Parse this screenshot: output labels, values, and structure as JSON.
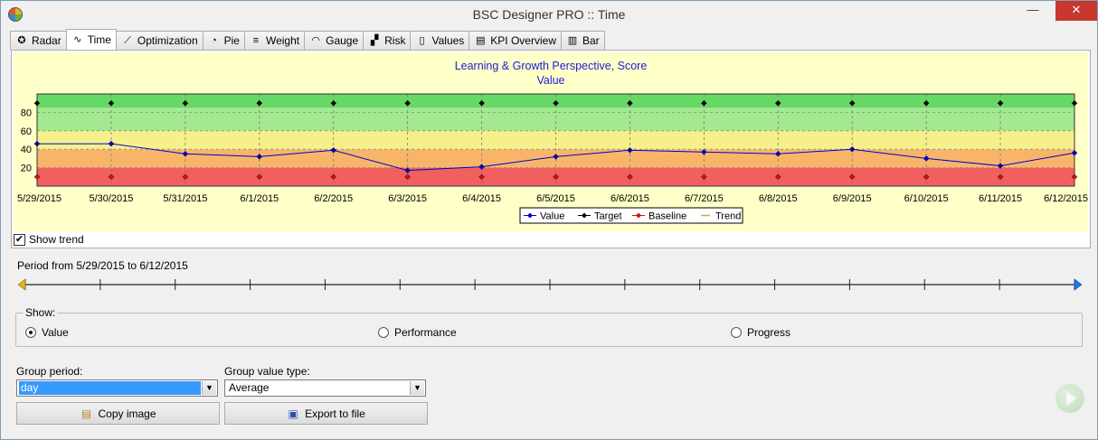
{
  "window": {
    "title": "BSC Designer PRO :: Time",
    "minimize": "—",
    "maximize": "□",
    "close": "✕"
  },
  "tabs": [
    {
      "label": "Radar",
      "icon": "radar-icon",
      "glyph": "✪"
    },
    {
      "label": "Time",
      "icon": "time-chart-icon",
      "glyph": "∿",
      "active": true
    },
    {
      "label": "Optimization",
      "icon": "optimization-icon",
      "glyph": "⟋"
    },
    {
      "label": "Pie",
      "icon": "pie-icon",
      "glyph": "◔"
    },
    {
      "label": "Weight",
      "icon": "weight-icon",
      "glyph": "≡"
    },
    {
      "label": "Gauge",
      "icon": "gauge-icon",
      "glyph": "◠"
    },
    {
      "label": "Risk",
      "icon": "risk-icon",
      "glyph": "▞"
    },
    {
      "label": "Values",
      "icon": "values-icon",
      "glyph": "▯"
    },
    {
      "label": "KPI Overview",
      "icon": "kpi-overview-icon",
      "glyph": "▤"
    },
    {
      "label": "Bar",
      "icon": "bar-icon",
      "glyph": "▥"
    }
  ],
  "chart_data": {
    "type": "line",
    "title": "Learning & Growth Perspective, Score",
    "subtitle": "Value",
    "categories": [
      "5/29/2015",
      "5/30/2015",
      "5/31/2015",
      "6/1/2015",
      "6/2/2015",
      "6/3/2015",
      "6/4/2015",
      "6/5/2015",
      "6/6/2015",
      "6/7/2015",
      "6/8/2015",
      "6/9/2015",
      "6/10/2015",
      "6/11/2015",
      "6/12/2015"
    ],
    "y_ticks": [
      20,
      40,
      60,
      80
    ],
    "ylim": [
      0,
      100
    ],
    "series": [
      {
        "name": "Value",
        "color": "#0000c8",
        "values": [
          46,
          46,
          35,
          32,
          39,
          17,
          21,
          32,
          39,
          37,
          35,
          40,
          30,
          22,
          36
        ]
      },
      {
        "name": "Target",
        "color": "#000000",
        "values": [
          90,
          90,
          90,
          90,
          90,
          90,
          90,
          90,
          90,
          90,
          90,
          90,
          90,
          90,
          90
        ]
      },
      {
        "name": "Baseline",
        "color": "#d01010",
        "values": [
          10,
          10,
          10,
          10,
          10,
          10,
          10,
          10,
          10,
          10,
          10,
          10,
          10,
          10,
          10
        ]
      },
      {
        "name": "Trend",
        "color": "#d9a441",
        "values": []
      }
    ],
    "bands": [
      {
        "from": 0,
        "to": 20,
        "color": "#f25f5f"
      },
      {
        "from": 20,
        "to": 40,
        "color": "#f8b56a"
      },
      {
        "from": 40,
        "to": 60,
        "color": "#f6f08a"
      },
      {
        "from": 60,
        "to": 85,
        "color": "#a3e98f"
      },
      {
        "from": 85,
        "to": 100,
        "color": "#66d866"
      }
    ],
    "grid": true,
    "legend_position": "bottom"
  },
  "show_trend": {
    "label": "Show trend",
    "checked": "✔"
  },
  "period": {
    "label": "Period from 5/29/2015 to 6/12/2015"
  },
  "show_group": {
    "title": "Show:",
    "options": [
      {
        "label": "Value",
        "selected": true
      },
      {
        "label": "Performance",
        "selected": false
      },
      {
        "label": "Progress",
        "selected": false
      }
    ]
  },
  "group_period": {
    "label": "Group period:",
    "value": "day"
  },
  "group_value_type": {
    "label": "Group value type:",
    "value": "Average"
  },
  "buttons": {
    "copy_image": "Copy image",
    "export_to_file": "Export to file"
  }
}
